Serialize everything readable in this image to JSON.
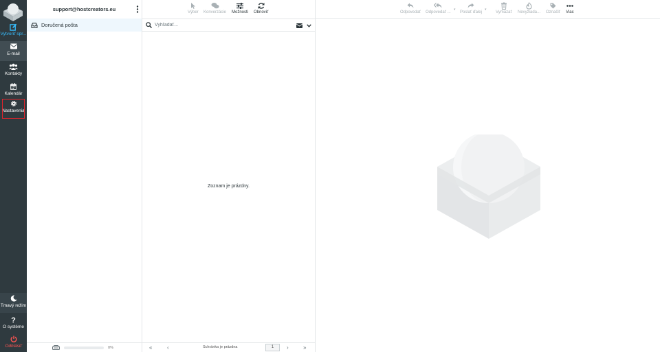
{
  "nav": {
    "compose": "Vytvoriť spr...",
    "mail": "E-mail",
    "contacts": "Kontakty",
    "calendar": "Kalendár",
    "settings": "Nastavenia",
    "dark_mode": "Tmavý režim",
    "about": "O systéme",
    "logout": "Odhlásiť"
  },
  "account": {
    "email": "support@hostcreators.eu"
  },
  "folders": [
    {
      "label": "Doručená pošta",
      "icon": "inbox-icon"
    }
  ],
  "quota": {
    "percent_label": "0%",
    "percent": 0
  },
  "list_toolbar": {
    "select": "Výber",
    "threads": "Konverzácie",
    "options": "Možnosti",
    "refresh": "Obnoviť"
  },
  "search": {
    "placeholder": "Vyhľadať..."
  },
  "list": {
    "empty_message": "Zoznam je prázdny."
  },
  "list_footer": {
    "status": "Schránka je prázdna",
    "page": "1"
  },
  "message_toolbar": {
    "reply": "Odpovedať",
    "reply_all": "Odpovedať ...",
    "forward": "Poslať ďalej",
    "delete": "Vymazať",
    "junk": "Nevyžiada...",
    "mark": "Označiť",
    "more": "Viac"
  },
  "colors": {
    "nav_bg": "#2f3a3f",
    "accent": "#37beff",
    "logout": "#ff5552",
    "highlight_box": "#e3242b",
    "selected_folder_bg": "#eef7fd"
  }
}
